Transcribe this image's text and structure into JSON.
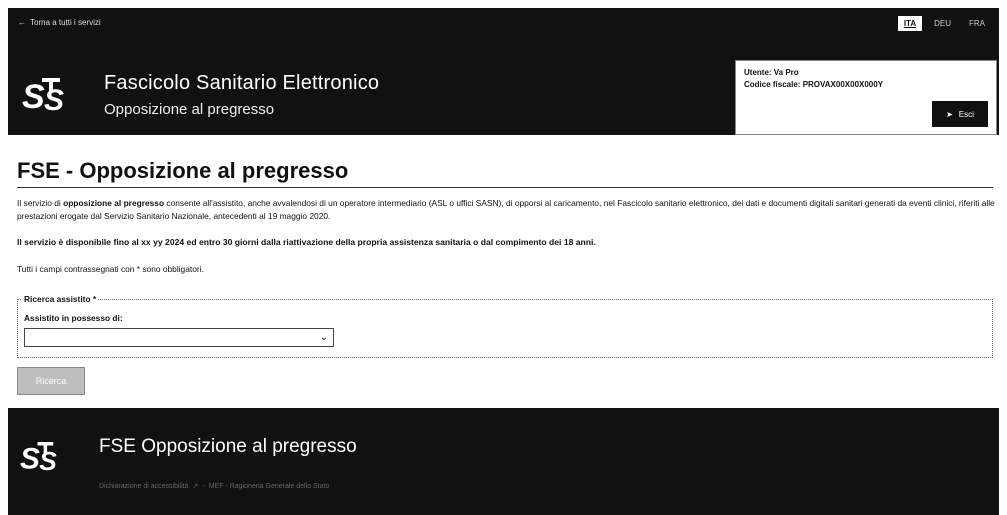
{
  "header": {
    "back_link": "Torna a tutti i servizi",
    "languages": [
      {
        "code": "ITA",
        "active": true
      },
      {
        "code": "DEU",
        "active": false
      },
      {
        "code": "FRA",
        "active": false
      }
    ],
    "logo_text": "STS",
    "app_title": "Fascicolo Sanitario Elettronico",
    "app_subtitle": "Opposizione al pregresso",
    "user": {
      "name_line": "Utente: Va Pro",
      "fiscal_code_line": "Codice fiscale: PROVAX00X00X000Y",
      "logout_label": "Esci"
    }
  },
  "main": {
    "page_title": "FSE - Opposizione al pregresso",
    "intro_prefix": "Il servizio di ",
    "intro_bold": "opposizione al pregresso",
    "intro_rest": " consente all'assistito, anche avvalendosi di un operatore intermediario (ASL o uffici SASN), di opporsi al caricamento, nel Fascicolo sanitario elettronico, dei dati e documenti digitali sanitari generati da eventi clinici, riferiti alle prestazioni erogate dal Servizio Sanitario Nazionale, antecedenti al 19 maggio 2020.",
    "availability": "Il servizio è disponibile fino al xx yy 2024 ed entro 30 giorni dalla riattivazione della propria assistenza sanitaria o dal compimento dei 18 anni.",
    "required_note": "Tutti i campi contrassegnati con * sono obbligatori.",
    "search_section": {
      "legend": "Ricerca assistito *",
      "field_label": "Assistito in possesso di:",
      "select_value": ""
    },
    "search_button": "Ricerca"
  },
  "footer": {
    "title": "FSE Opposizione al pregresso",
    "link1": "Dichiarazione di accessibilità",
    "separator": "-",
    "link2": "MEF - Ragioneria Generale dello Stato"
  }
}
